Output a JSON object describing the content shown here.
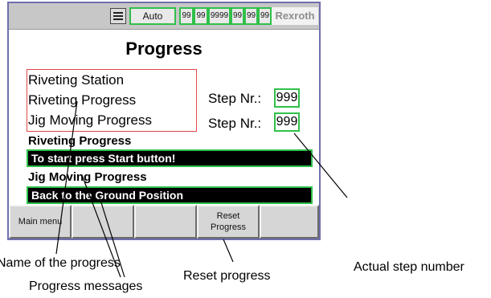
{
  "statusbar": {
    "menu_icon": "menu-icon",
    "mode": "Auto",
    "datetime": [
      "99",
      "99",
      "9999",
      "99",
      "99",
      "99"
    ],
    "brand": "Rexroth"
  },
  "screen": {
    "title": "Progress",
    "names": [
      "Riveting Station",
      "Riveting Progress",
      "Jig Moving Progress"
    ],
    "step_label": "Step Nr.:",
    "steps": [
      "999",
      "999"
    ],
    "sections": [
      {
        "label": "Riveting Progress",
        "message": "To start press Start button!"
      },
      {
        "label": "Jig Moving Progress",
        "message": "Back to the Ground Position"
      }
    ]
  },
  "softkeys": [
    "Main menu",
    "",
    "",
    "Reset Progress",
    ""
  ],
  "annotations": {
    "name": "Name of the progress",
    "messages": "Progress messages",
    "reset": "Reset progress",
    "step": "Actual step number"
  },
  "colors": {
    "frame": "#6f6fb0",
    "highlight_green": "#2fc04a",
    "highlight_red": "#e04848",
    "message_bg": "#000000"
  }
}
